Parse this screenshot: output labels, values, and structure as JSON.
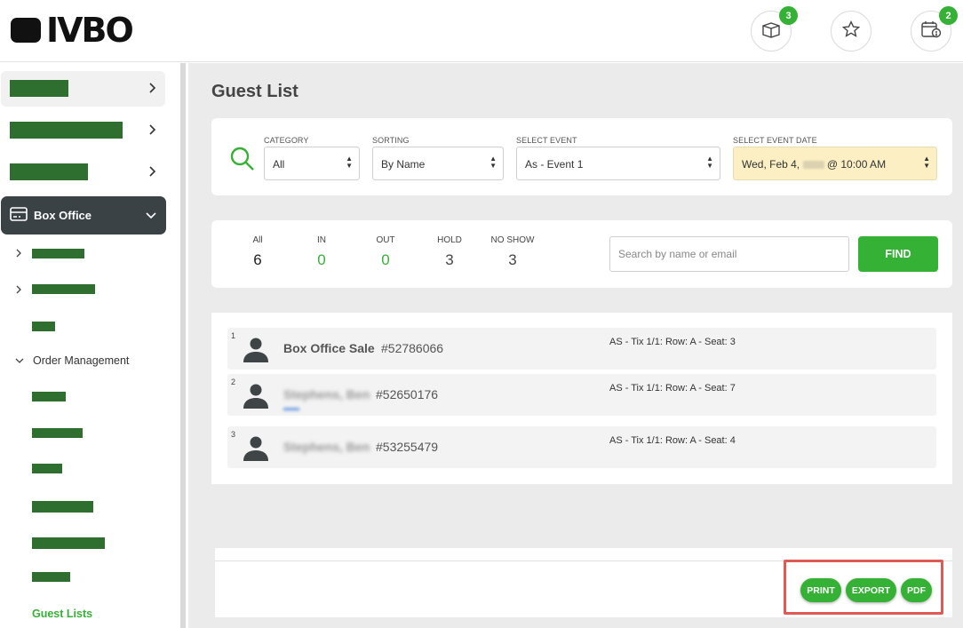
{
  "header": {
    "logo_text": "IVBO",
    "notifications": [
      {
        "icon": "box-icon",
        "badge": "3"
      },
      {
        "icon": "star-icon",
        "badge": ""
      },
      {
        "icon": "calendar-alert-icon",
        "badge": "2"
      }
    ]
  },
  "sidebar": {
    "box_office_label": "Box Office",
    "order_management_label": "Order Management",
    "guest_lists_label": "Guest Lists"
  },
  "page": {
    "title": "Guest List"
  },
  "filters": {
    "category": {
      "label": "CATEGORY",
      "value": "All"
    },
    "sorting": {
      "label": "SORTING",
      "value": "By Name"
    },
    "event": {
      "label": "SELECT EVENT",
      "value": "As - Event 1"
    },
    "event_date": {
      "label": "SELECT EVENT DATE",
      "value_prefix": "Wed, Feb 4,",
      "value_suffix": "@ 10:00 AM"
    }
  },
  "stats": [
    {
      "label": "All",
      "value": "6",
      "color": "#222222"
    },
    {
      "label": "IN",
      "value": "0",
      "color": "#35b135"
    },
    {
      "label": "OUT",
      "value": "0",
      "color": "#35b135"
    },
    {
      "label": "HOLD",
      "value": "3",
      "color": "#444444"
    },
    {
      "label": "NO SHOW",
      "value": "3",
      "color": "#444444"
    }
  ],
  "search": {
    "placeholder": "Search by name or email",
    "find_label": "FIND"
  },
  "guests": [
    {
      "num": "1",
      "name": "Box Office Sale",
      "order": "#52786066",
      "seat": "AS - Tix 1/1: Row: A - Seat: 3"
    },
    {
      "num": "2",
      "name": "Stephens, Ben",
      "order": "#52650176",
      "seat": "AS - Tix 1/1: Row: A - Seat: 7"
    },
    {
      "num": "3",
      "name": "Stephens, Ben",
      "order": "#53255479",
      "seat": "AS - Tix 1/1: Row: A - Seat: 4"
    }
  ],
  "actions": {
    "print": "PRINT",
    "export": "EXPORT",
    "pdf": "PDF"
  },
  "colors": {
    "accent": "#35b135",
    "sidebar_active": "#3b4246",
    "date_highlight": "#fcefc4",
    "annotation": "#e05a55"
  }
}
